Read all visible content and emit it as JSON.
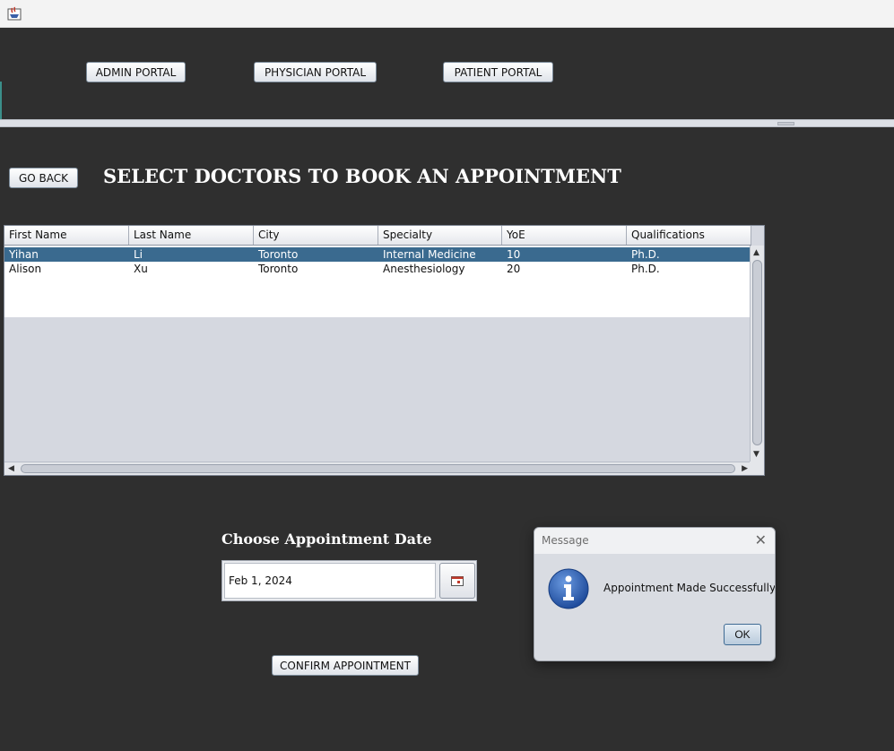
{
  "window": {
    "icon": "java-app-icon"
  },
  "portals": {
    "admin": "ADMIN PORTAL",
    "physician": "PHYSICIAN PORTAL",
    "patient": "PATIENT PORTAL"
  },
  "go_back": "GO BACK",
  "heading": "SELECT DOCTORS TO BOOK AN APPOINTMENT",
  "table": {
    "columns": [
      "First Name",
      "Last Name",
      "City",
      "Specialty",
      "YoE",
      "Qualifications"
    ],
    "rows": [
      [
        "Yihan",
        "Li",
        "Toronto",
        "Internal Medicine",
        "10",
        "Ph.D."
      ],
      [
        "Alison",
        "Xu",
        "Toronto",
        "Anesthesiology",
        "20",
        "Ph.D."
      ]
    ],
    "selected_row": 0
  },
  "date": {
    "label": "Choose Appointment Date",
    "value": "Feb 1, 2024",
    "picker_icon": "calendar-icon"
  },
  "confirm": "CONFIRM APPOINTMENT",
  "dialog": {
    "title": "Message",
    "message": "Appointment Made Successfully!",
    "ok": "OK",
    "icon": "info-icon"
  },
  "colors": {
    "background": "#2f2f2f",
    "selected_row": "#3a6a8f",
    "info_blue": "#2c5fb2"
  }
}
